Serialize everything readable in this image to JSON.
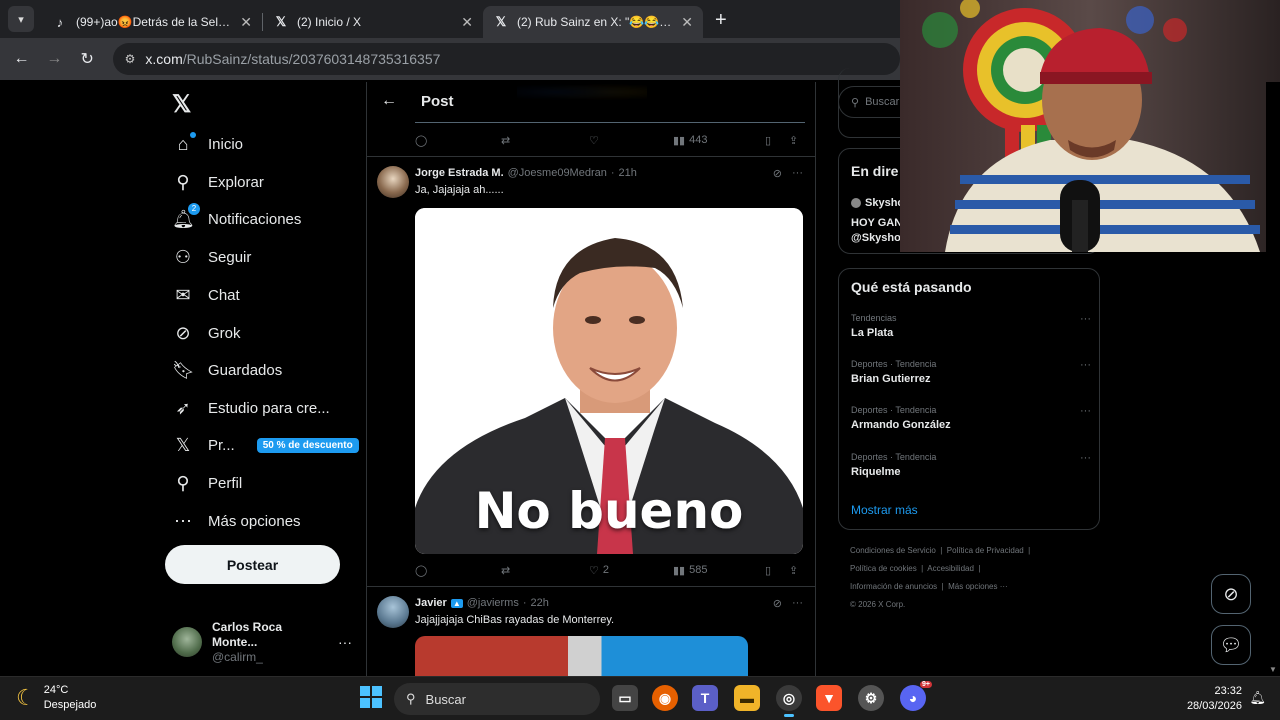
{
  "browser": {
    "tabs": [
      {
        "favicon": "tiktok-icon",
        "title": "(99+)ao😡Detrás de la Selección",
        "active": false
      },
      {
        "favicon": "x-icon",
        "title": "(2) Inicio / X",
        "active": false
      },
      {
        "favicon": "x-icon",
        "title": "(2) Rub Sainz en X: \"😂😂😂😂",
        "active": true
      }
    ],
    "url_domain": "x.com",
    "url_path": "/RubSainz/status/2037603148735316357"
  },
  "sidebar": {
    "items": [
      {
        "label": "Inicio",
        "icon": "home-icon"
      },
      {
        "label": "Explorar",
        "icon": "search-icon"
      },
      {
        "label": "Notificaciones",
        "icon": "bell-icon",
        "badge": "2"
      },
      {
        "label": "Seguir",
        "icon": "add-person-icon"
      },
      {
        "label": "Chat",
        "icon": "mail-icon"
      },
      {
        "label": "Grok",
        "icon": "grok-icon"
      },
      {
        "label": "Guardados",
        "icon": "bookmark-icon"
      },
      {
        "label": "Estudio para cre...",
        "icon": "rocket-icon"
      },
      {
        "label": "Pr...",
        "icon": "x-icon",
        "pill": "50 % de descuento"
      },
      {
        "label": "Perfil",
        "icon": "person-icon"
      },
      {
        "label": "Más opciones",
        "icon": "more-circle-icon"
      }
    ],
    "post_button": "Postear",
    "account": {
      "name": "Carlos Roca Monte...",
      "handle": "@calirm_"
    }
  },
  "timeline": {
    "header_title": "Post",
    "top_actions": {
      "views": "443"
    },
    "tweets": [
      {
        "name": "Jorge Estrada M.",
        "handle": "@Joesme09Medran",
        "time": "21h",
        "text": "Ja, Jajajaja ah......",
        "media_caption": "No bueno",
        "likes": "2",
        "views": "585"
      },
      {
        "name": "Javier",
        "handle": "@javierms",
        "time": "22h",
        "text": "Jajajjajaja ChiBas rayadas de Monterrey."
      }
    ]
  },
  "right": {
    "search_placeholder": "Buscar",
    "live": {
      "title": "En dire",
      "account": "Skysho",
      "line1": "HOY GAN",
      "line2": "@Skysho"
    },
    "trending_title": "Qué está pasando",
    "trends": [
      {
        "meta": "Tendencias",
        "topic": "La Plata"
      },
      {
        "meta": "Deportes · Tendencia",
        "topic": "Brian Gutierrez"
      },
      {
        "meta": "Deportes · Tendencia",
        "topic": "Armando González"
      },
      {
        "meta": "Deportes · Tendencia",
        "topic": "Riquelme"
      }
    ],
    "show_more": "Mostrar más",
    "footer": [
      "Condiciones de Servicio",
      "Política de Privacidad",
      "Política de cookies",
      "Accesibilidad",
      "Información de anuncios",
      "Más opciones ···",
      "© 2026 X Corp."
    ]
  },
  "taskbar": {
    "weather_temp": "24°C",
    "weather_desc": "Despejado",
    "search_label": "Buscar",
    "time": "23:32",
    "date": "28/03/2026",
    "discord_badge": "9+"
  },
  "colors": {
    "accent": "#1d9bf0",
    "background": "#000000",
    "border": "#2f3336",
    "muted": "#71767b"
  }
}
